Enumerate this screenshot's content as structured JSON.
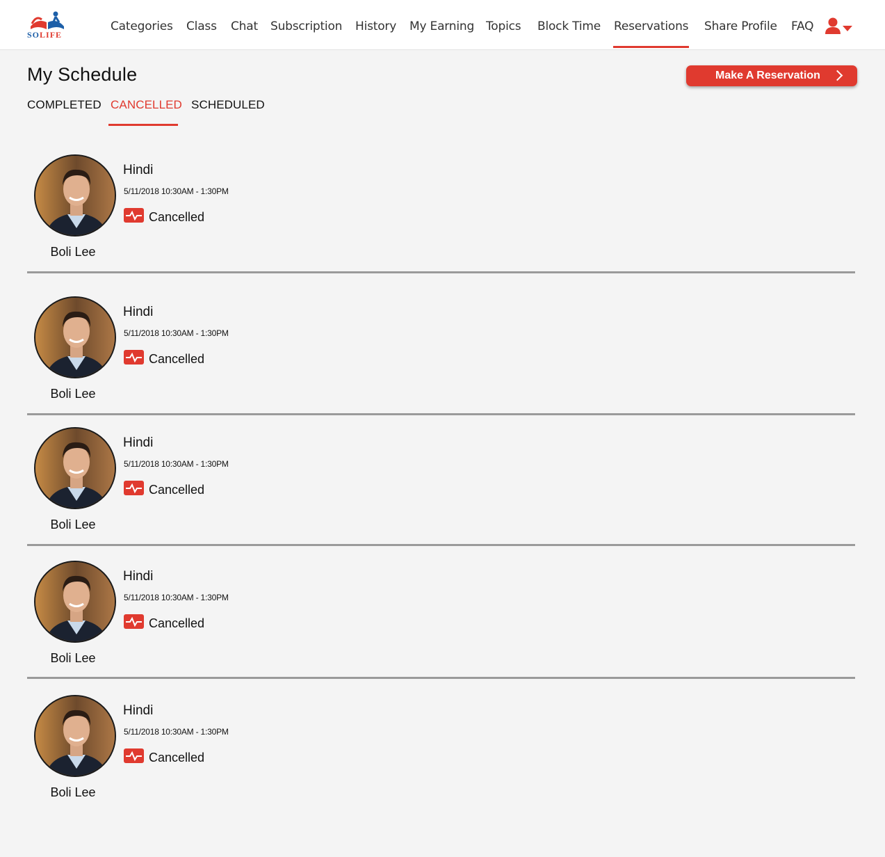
{
  "brand": {
    "logo_so": "SO",
    "logo_life": "LIFE"
  },
  "nav": [
    {
      "label": "Categories",
      "active": false
    },
    {
      "label": "Class",
      "active": false
    },
    {
      "label": "Chat",
      "active": false
    },
    {
      "label": "Subscription",
      "active": false
    },
    {
      "label": "History",
      "active": false
    },
    {
      "label": "My Earning",
      "active": false
    },
    {
      "label": "Topics",
      "active": false
    },
    {
      "label": "Block Time",
      "active": false
    },
    {
      "label": "Reservations",
      "active": true
    },
    {
      "label": "Share Profile",
      "active": false
    },
    {
      "label": "FAQ",
      "active": false
    }
  ],
  "user_menu": {
    "icon": "user-icon",
    "caret": "chevron-down-icon"
  },
  "page_title": "My Schedule",
  "reserve_button": {
    "label": "Make A Reservation",
    "icon": "chevron-right-icon"
  },
  "tabs": [
    {
      "label": "COMPLETED",
      "active": false
    },
    {
      "label": "CANCELLED",
      "active": true
    },
    {
      "label": "SCHEDULED",
      "active": false
    }
  ],
  "reservations": [
    {
      "tutor": "Boli Lee",
      "subject": "Hindi",
      "datetime": "5/11/2018 10:30AM - 1:30PM",
      "status": "Cancelled",
      "status_icon": "pulse-icon"
    },
    {
      "tutor": "Boli Lee",
      "subject": "Hindi",
      "datetime": "5/11/2018 10:30AM - 1:30PM",
      "status": "Cancelled",
      "status_icon": "pulse-icon"
    },
    {
      "tutor": "Boli Lee",
      "subject": "Hindi",
      "datetime": "5/11/2018 10:30AM - 1:30PM",
      "status": "Cancelled",
      "status_icon": "pulse-icon"
    },
    {
      "tutor": "Boli Lee",
      "subject": "Hindi",
      "datetime": "5/11/2018 10:30AM - 1:30PM",
      "status": "Cancelled",
      "status_icon": "pulse-icon"
    },
    {
      "tutor": "Boli Lee",
      "subject": "Hindi",
      "datetime": "5/11/2018 10:30AM - 1:30PM",
      "status": "Cancelled",
      "status_icon": "pulse-icon"
    }
  ],
  "colors": {
    "accent": "#e03a2f",
    "brand_blue": "#1d5fa8",
    "background": "#f4f4f4",
    "divider": "#9a9a9a"
  }
}
